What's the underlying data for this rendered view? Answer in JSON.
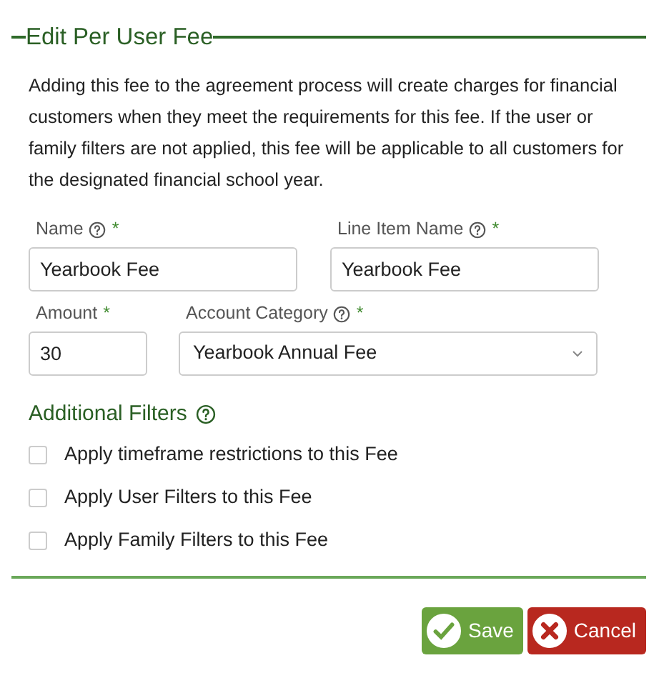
{
  "title": "Edit Per User Fee",
  "description": "Adding this fee to the agreement process will create charges for financial customers when they meet the requirements for this fee. If the user or family filters are not applied, this fee will be applicable to all customers for the designated financial school year.",
  "fields": [
    {
      "label": "Name",
      "help": true,
      "required_mark": "*",
      "value": "Yearbook Fee",
      "kind": "text"
    },
    {
      "label": "Line Item Name",
      "help": true,
      "required_mark": "*",
      "value": "Yearbook Fee",
      "kind": "text"
    },
    {
      "label": "Amount",
      "help": false,
      "required_mark": "*",
      "value": "30",
      "kind": "text"
    },
    {
      "label": "Account Category",
      "help": true,
      "required_mark": "*",
      "value": "Yearbook Annual Fee",
      "kind": "select"
    }
  ],
  "filters_heading": "Additional Filters",
  "filters": [
    {
      "label": "Apply timeframe restrictions to this Fee",
      "checked": false
    },
    {
      "label": "Apply User Filters to this Fee",
      "checked": false
    },
    {
      "label": "Apply Family Filters to this Fee",
      "checked": false
    }
  ],
  "buttons": [
    {
      "label": "Save",
      "kind": "save"
    },
    {
      "label": "Cancel",
      "kind": "cancel"
    }
  ]
}
